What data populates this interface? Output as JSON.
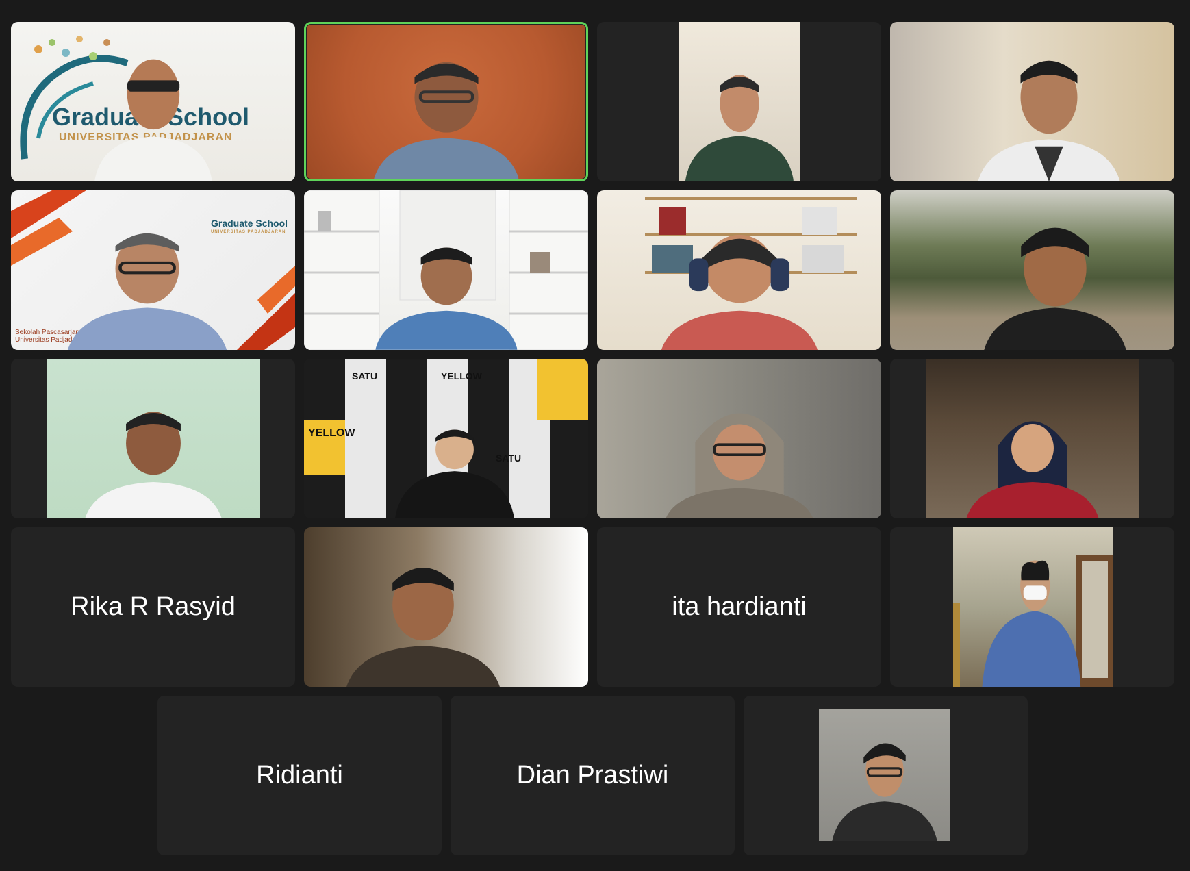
{
  "meeting": {
    "layout": "gallery",
    "active_speaker_color": "#5fd35a",
    "background_color": "#1a1a1a",
    "tile_color": "#232323"
  },
  "tiles": {
    "t1": {
      "kind": "video",
      "overlay_text": "Graduate School",
      "overlay_subtext": "UNIVERSITAS PADJADJARAN"
    },
    "t2": {
      "kind": "video",
      "active_speaker": true
    },
    "t3": {
      "kind": "video"
    },
    "t4": {
      "kind": "video"
    },
    "t5": {
      "kind": "video",
      "overlay_text": "Graduate School",
      "overlay_subtext": "UNIVERSITAS PADJADJARAN",
      "overlay_footer": "Sekolah Pascasarjana Universitas Padjadjaran"
    },
    "t6": {
      "kind": "video"
    },
    "t7": {
      "kind": "video"
    },
    "t8": {
      "kind": "video"
    },
    "t9": {
      "kind": "video"
    },
    "t10": {
      "kind": "video",
      "poster_text": "YELLOW"
    },
    "t11": {
      "kind": "video"
    },
    "t12": {
      "kind": "video"
    },
    "t13": {
      "kind": "name",
      "name": "Rika R Rasyid"
    },
    "t14": {
      "kind": "video"
    },
    "t15": {
      "kind": "name",
      "name": "ita hardianti"
    },
    "t16": {
      "kind": "video"
    },
    "t17": {
      "kind": "name",
      "name": "Ridianti"
    },
    "t18": {
      "kind": "name",
      "name": "Dian Prastiwi"
    },
    "t19": {
      "kind": "video"
    }
  }
}
